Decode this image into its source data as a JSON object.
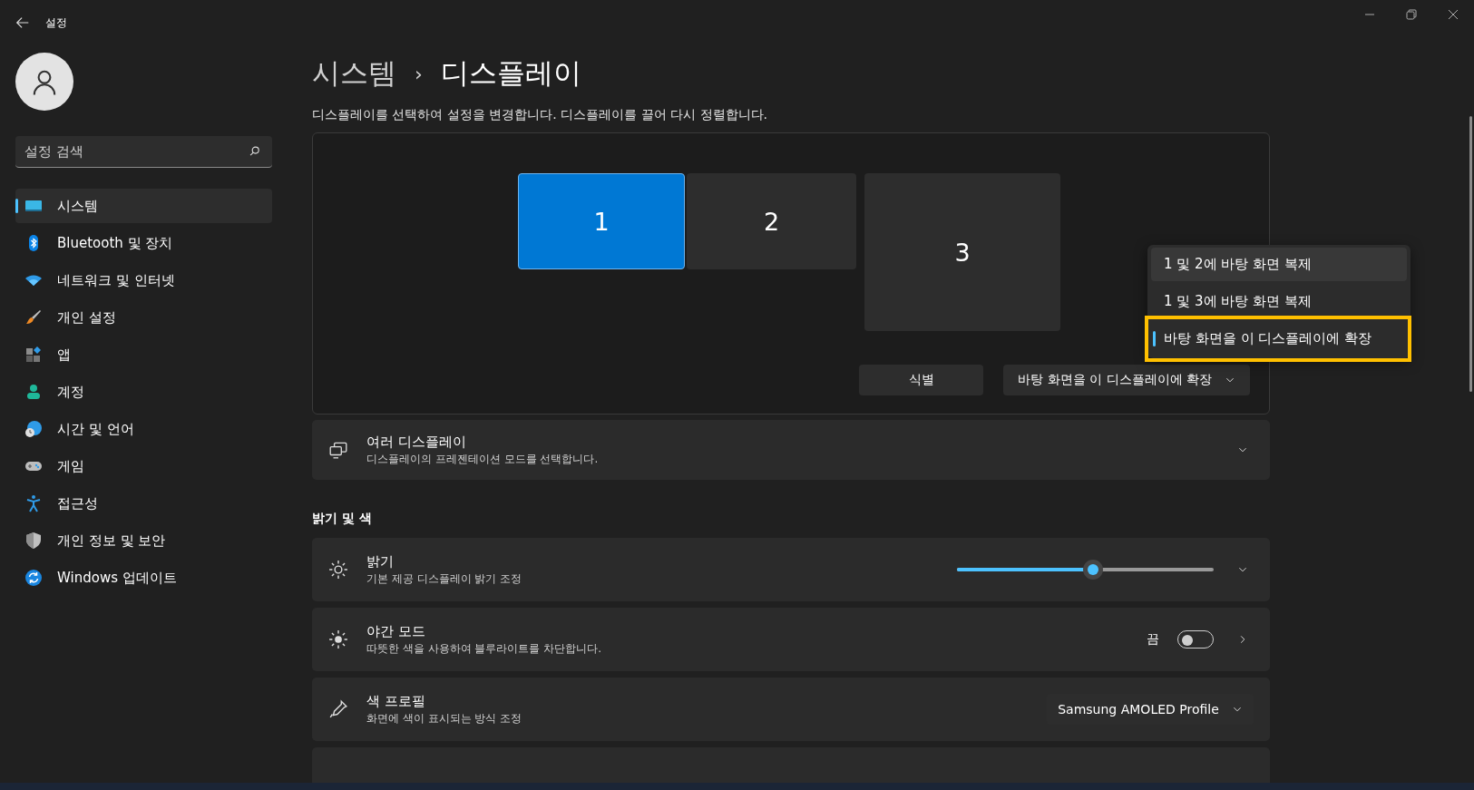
{
  "window": {
    "title": "설정"
  },
  "search": {
    "placeholder": "설정 검색"
  },
  "sidebar": {
    "items": [
      {
        "kind": "system",
        "label": "시스템",
        "selected": true
      },
      {
        "kind": "bluetooth",
        "label": "Bluetooth 및 장치",
        "selected": false
      },
      {
        "kind": "network",
        "label": "네트워크 및 인터넷",
        "selected": false
      },
      {
        "kind": "personalization",
        "label": "개인 설정",
        "selected": false
      },
      {
        "kind": "apps",
        "label": "앱",
        "selected": false
      },
      {
        "kind": "accounts",
        "label": "계정",
        "selected": false
      },
      {
        "kind": "time",
        "label": "시간 및 언어",
        "selected": false
      },
      {
        "kind": "gaming",
        "label": "게임",
        "selected": false
      },
      {
        "kind": "accessibility",
        "label": "접근성",
        "selected": false
      },
      {
        "kind": "privacy",
        "label": "개인 정보 및 보안",
        "selected": false
      },
      {
        "kind": "update",
        "label": "Windows 업데이트",
        "selected": false
      }
    ]
  },
  "breadcrumb": {
    "parent": "시스템",
    "separator": "›",
    "current": "디스플레이"
  },
  "description": "디스플레이를 선택하여 설정을 변경합니다. 디스플레이를 끌어 다시 정렬합니다.",
  "arrangement": {
    "displays": [
      {
        "label": "1",
        "selected": true
      },
      {
        "label": "2",
        "selected": false
      },
      {
        "label": "3",
        "selected": false
      }
    ],
    "identify_button": "식별",
    "mode_dropdown": {
      "value": "바탕 화면을 이 디스플레이에 확장",
      "expanded": true
    }
  },
  "mode_menu": {
    "items": [
      {
        "label": "1 및 2에 바탕 화면 복제",
        "selected": false,
        "hovered": true,
        "highlighted": false
      },
      {
        "label": "1 및 3에 바탕 화면 복제",
        "selected": false,
        "hovered": false,
        "highlighted": false
      },
      {
        "label": "바탕 화면을 이 디스플레이에 확장",
        "selected": true,
        "hovered": false,
        "highlighted": true
      }
    ]
  },
  "multiple_displays": {
    "title": "여러 디스플레이",
    "subtitle": "디스플레이의 프레젠테이션 모드를 선택합니다.",
    "expanded": false
  },
  "section_title": "밝기 및 색",
  "settings": [
    {
      "kind": "slider",
      "title": "밝기",
      "subtitle": "기본 제공 디스플레이 밝기 조정",
      "level": 0.53,
      "expanded": false
    },
    {
      "kind": "toggle",
      "title": "야간 모드",
      "subtitle": "따뜻한 색을 사용하여 블루라이트를 차단합니다.",
      "state_label": "끔",
      "on": false
    },
    {
      "kind": "dropdown",
      "title": "색 프로필",
      "subtitle": "화면에 색이 표시되는 방식 조정",
      "value": "Samsung AMOLED Profile"
    }
  ]
}
